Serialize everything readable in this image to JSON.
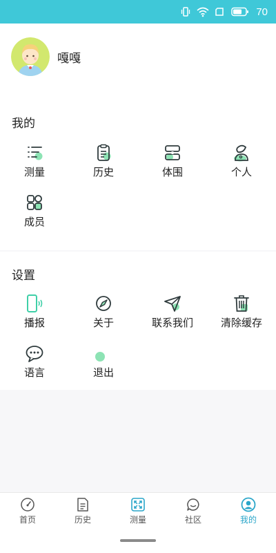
{
  "status_bar": {
    "battery_level": "70"
  },
  "profile": {
    "nickname": "嘎嘎"
  },
  "mine_section": {
    "title": "我的",
    "items": [
      {
        "label": "测量",
        "icon": "list-icon"
      },
      {
        "label": "历史",
        "icon": "clipboard-icon"
      },
      {
        "label": "体围",
        "icon": "body-measure-icon"
      },
      {
        "label": "个人",
        "icon": "person-icon"
      },
      {
        "label": "成员",
        "icon": "members-icon"
      }
    ]
  },
  "settings_section": {
    "title": "设置",
    "items": [
      {
        "label": "播报",
        "icon": "phone-broadcast-icon"
      },
      {
        "label": "关于",
        "icon": "compass-icon"
      },
      {
        "label": "联系我们",
        "icon": "paper-plane-icon"
      },
      {
        "label": "清除缓存",
        "icon": "trash-icon"
      },
      {
        "label": "语言",
        "icon": "chat-bubble-icon"
      },
      {
        "label": "退出",
        "icon": "logout-dot-icon"
      }
    ]
  },
  "tab_bar": {
    "tabs": [
      {
        "label": "首页",
        "icon": "gauge-icon",
        "active": false
      },
      {
        "label": "历史",
        "icon": "document-icon",
        "active": false
      },
      {
        "label": "测量",
        "icon": "scan-icon",
        "active": false
      },
      {
        "label": "社区",
        "icon": "chat-icon",
        "active": false
      },
      {
        "label": "我的",
        "icon": "user-circle-icon",
        "active": true
      }
    ]
  },
  "colors": {
    "accent": "#2aa6c9",
    "status_bar": "#3fc8d8",
    "icon_highlight": "#8de3b4"
  }
}
